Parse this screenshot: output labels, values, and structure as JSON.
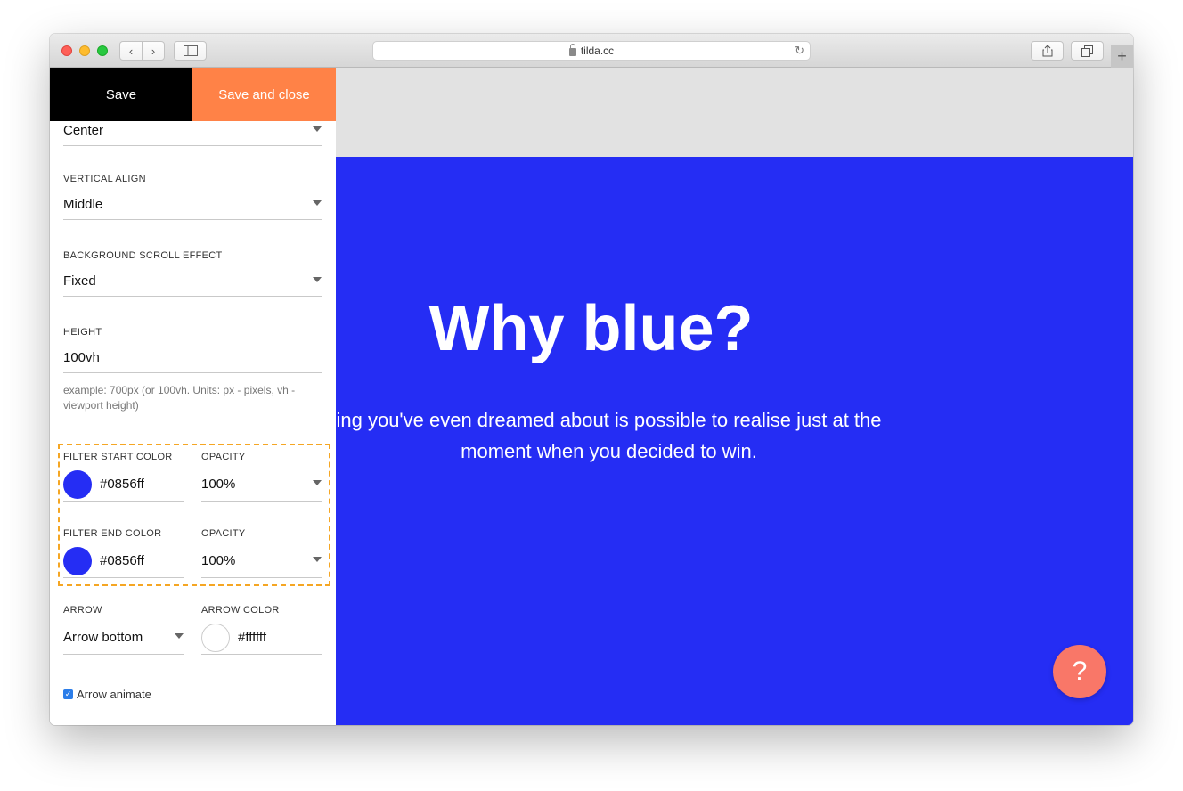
{
  "browser": {
    "url": "tilda.cc"
  },
  "toolbar": {
    "save_label": "Save",
    "save_close_label": "Save and close"
  },
  "settings": {
    "horizontal_align_value": "Center",
    "vertical_align": {
      "label": "VERTICAL ALIGN",
      "value": "Middle"
    },
    "scroll_effect": {
      "label": "BACKGROUND SCROLL EFFECT",
      "value": "Fixed"
    },
    "height": {
      "label": "HEIGHT",
      "value": "100vh",
      "hint": "example: 700px (or 100vh. Units: px - pixels, vh - viewport height)"
    },
    "filter_start": {
      "label": "FILTER START COLOR",
      "value": "#0856ff",
      "color": "#252df4"
    },
    "filter_start_opacity": {
      "label": "OPACITY",
      "value": "100%"
    },
    "filter_end": {
      "label": "FILTER END COLOR",
      "value": "#0856ff",
      "color": "#252df4"
    },
    "filter_end_opacity": {
      "label": "OPACITY",
      "value": "100%"
    },
    "arrow": {
      "label": "ARROW",
      "value": "Arrow bottom"
    },
    "arrow_color": {
      "label": "ARROW COLOR",
      "value": "#ffffff"
    },
    "arrow_animate": {
      "label": "Arrow animate",
      "checked": true
    }
  },
  "preview": {
    "title": "Why blue?",
    "subtitle": "ing you've even dreamed about is possible to realise just at the moment when you decided to win.",
    "hero_color": "#252df4",
    "help_label": "?"
  },
  "colors": {
    "accent": "#ff8247",
    "highlight": "#f5a623"
  }
}
